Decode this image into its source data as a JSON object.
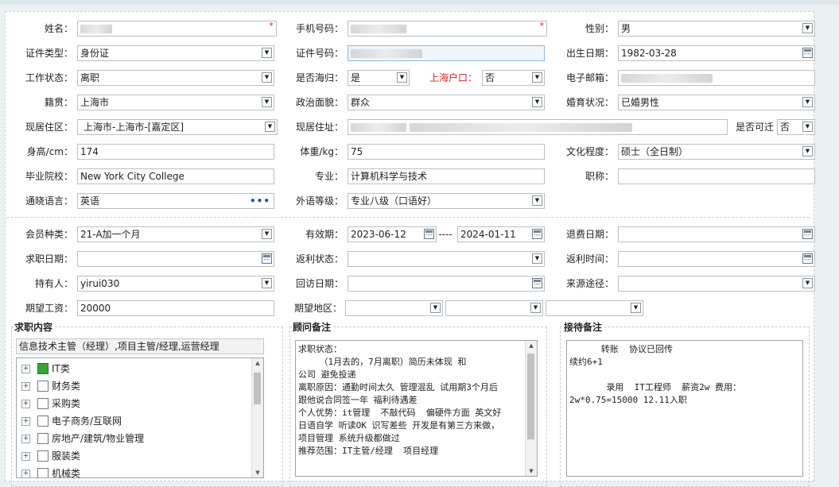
{
  "form": {
    "name": {
      "label": "姓名：",
      "value": ""
    },
    "mobile": {
      "label": "手机号码：",
      "value": ""
    },
    "gender": {
      "label": "性别：",
      "value": "男"
    },
    "id_type": {
      "label": "证件类型：",
      "value": "身份证"
    },
    "id_no": {
      "label": "证件号码：",
      "value": ""
    },
    "birth": {
      "label": "出生日期：",
      "value": "1982-03-28"
    },
    "work_status": {
      "label": "工作状态：",
      "value": "离职"
    },
    "overseas": {
      "label": "是否海归：",
      "value": "是"
    },
    "sh_hukou": {
      "label": "上海户口：",
      "value": "否"
    },
    "email": {
      "label": "电子邮箱：",
      "value": ""
    },
    "native": {
      "label": "籍贯：",
      "value": "上海市"
    },
    "politics": {
      "label": "政治面貌：",
      "value": "群众"
    },
    "marital": {
      "label": "婚育状况：",
      "value": "已婚男性"
    },
    "residence": {
      "label": "现居住区：",
      "value": "上海市-上海市-[嘉定区]"
    },
    "address": {
      "label": "现居住址：",
      "value": ""
    },
    "relocate": {
      "label": "是否可迁",
      "value": "否"
    },
    "height": {
      "label": "身高/cm：",
      "value": "174"
    },
    "weight": {
      "label": "体重/kg：",
      "value": "75"
    },
    "education": {
      "label": "文化程度：",
      "value": "硕士（全日制）"
    },
    "school": {
      "label": "毕业院校：",
      "value": "New York City College"
    },
    "major": {
      "label": "专业：",
      "value": "计算机科学与技术"
    },
    "title": {
      "label": "职称：",
      "value": ""
    },
    "language": {
      "label": "通晓语言：",
      "value": "英语"
    },
    "lang_level": {
      "label": "外语等级：",
      "value": "专业八级（口语好）"
    }
  },
  "membership": {
    "type": {
      "label": "会员种类：",
      "value": "21-A加一个月"
    },
    "valid": {
      "label": "有效期：",
      "from": "2023-06-12",
      "sep": "----",
      "to": "2024-01-11"
    },
    "refund_date": {
      "label": "退费日期：",
      "value": ""
    },
    "job_date": {
      "label": "求职日期：",
      "value": ""
    },
    "rebate_status": {
      "label": "返利状态：",
      "value": ""
    },
    "rebate_time": {
      "label": "返利时间：",
      "value": ""
    },
    "holder": {
      "label": "持有人：",
      "value": "yirui030"
    },
    "visit_date": {
      "label": "回访日期：",
      "value": ""
    },
    "source": {
      "label": "来源途径：",
      "value": ""
    },
    "salary": {
      "label": "期望工资：",
      "value": "20000"
    },
    "region": {
      "label": "期望地区：",
      "value": ""
    }
  },
  "job": {
    "title": "求职内容",
    "summary": "信息技术主管（经理）,项目主管/经理,运营经理",
    "tree": [
      {
        "label": "IT类",
        "checked": true
      },
      {
        "label": "财务类",
        "checked": false
      },
      {
        "label": "采购类",
        "checked": false
      },
      {
        "label": "电子商务/互联网",
        "checked": false
      },
      {
        "label": "房地产/建筑/物业管理",
        "checked": false
      },
      {
        "label": "服装类",
        "checked": false
      },
      {
        "label": "机械类",
        "checked": false
      }
    ]
  },
  "consultant": {
    "title": "顾问备注",
    "text": "求职状态：\n    （1月去的，7月离职）简历未体现 和\n公司 避免投递\n离职原因：通勤时间太久 管理混乱 试用期3个月后\n跟他说合同签一年 福利待遇差\n个人优势：it管理  不敲代码  偏硬件方面 英文好\n日语自学 听读OK 识写差些 开发是有第三方来做，\n项目管理 系统升级都做过\n推荐范围：IT主管/经理  项目经理"
  },
  "reception": {
    "title": "接待备注",
    "text": "      转账  协议已回传\n续约6+1\n\n       录用  IT工程师  薪资2w 费用：\n2w*0.75=15000 12.11入职"
  }
}
